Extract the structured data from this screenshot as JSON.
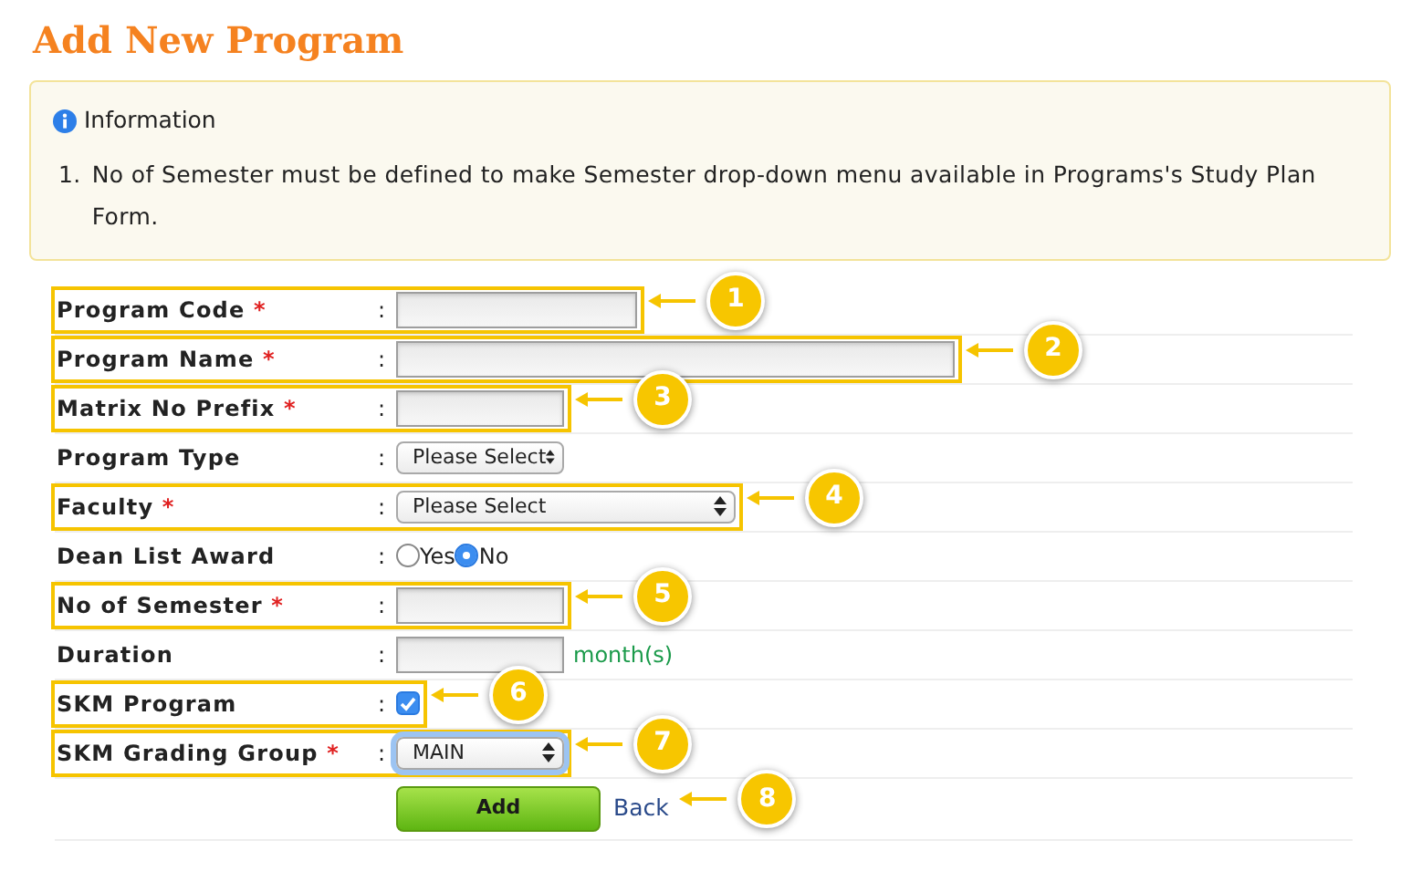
{
  "title": "Add New Program",
  "info": {
    "heading": "Information",
    "items": [
      {
        "number": "1.",
        "text": "No of Semester must be defined to make Semester drop-down menu available in Programs's Study Plan Form."
      }
    ]
  },
  "fields": [
    {
      "kind": "text",
      "label": "Program Code",
      "required_mark": "*",
      "separator": ":",
      "highlighted": true,
      "callout": "1"
    },
    {
      "kind": "text",
      "label": "Program Name",
      "required_mark": "*",
      "separator": ":",
      "highlighted": true,
      "callout": "2"
    },
    {
      "kind": "text",
      "label": "Matrix No Prefix",
      "required_mark": "*",
      "separator": ":",
      "highlighted": true,
      "callout": "3"
    },
    {
      "kind": "select",
      "label": "Program Type",
      "separator": ":",
      "value": "Please Select",
      "focused": false,
      "highlighted": false
    },
    {
      "kind": "select",
      "label": "Faculty",
      "required_mark": "*",
      "separator": ":",
      "value": "Please Select",
      "focused": false,
      "highlighted": true,
      "callout": "4"
    },
    {
      "kind": "radio",
      "label": "Dean List Award",
      "separator": ":",
      "highlighted": false,
      "options": [
        {
          "label": "Yes",
          "selected": false
        },
        {
          "label": "No",
          "selected": true
        }
      ]
    },
    {
      "kind": "text",
      "label": "No of Semester",
      "required_mark": "*",
      "separator": ":",
      "highlighted": true,
      "callout": "5"
    },
    {
      "kind": "text",
      "label": "Duration",
      "separator": ":",
      "unit": "month(s)",
      "highlighted": false
    },
    {
      "kind": "checkbox",
      "label": "SKM Program",
      "separator": ":",
      "checked": true,
      "highlighted": true,
      "callout": "6"
    },
    {
      "kind": "select",
      "label": "SKM Grading Group",
      "required_mark": "*",
      "separator": ":",
      "value": "MAIN",
      "focused": true,
      "highlighted": true,
      "callout": "7"
    }
  ],
  "actions": {
    "button": "Add",
    "link": "Back",
    "callout": "8"
  }
}
